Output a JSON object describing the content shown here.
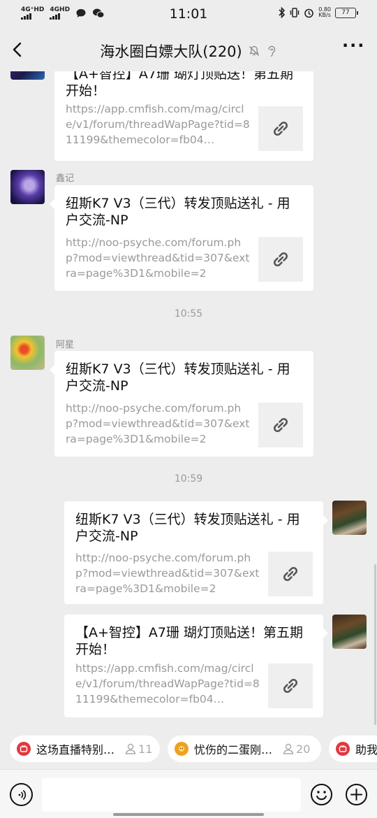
{
  "status": {
    "net1": "4G⁺HD",
    "net2": "4GHD",
    "time": "11:01",
    "speed_value": "0.80",
    "speed_unit": "KB/s",
    "battery": "77"
  },
  "header": {
    "title": "海水圈白嫖大队(220)"
  },
  "messages": [
    {
      "title": "【A+智控】A7珊 瑚灯顶贴送！第五期开始！",
      "desc": "https://app.cmfish.com/mag/circle/v1/forum/threadWapPage?tid=811199&themecolor=fb04…"
    },
    {
      "sender": "鑫记",
      "title": "纽斯K7 V3（三代）转发顶贴送礼 - 用户交流-NP",
      "desc": "http://noo-psyche.com/forum.php?mod=viewthread&tid=307&extra=page%3D1&mobile=2"
    },
    {
      "time": "10:55"
    },
    {
      "sender": "阿星",
      "title": "纽斯K7 V3（三代）转发顶贴送礼 - 用户交流-NP",
      "desc": "http://noo-psyche.com/forum.php?mod=viewthread&tid=307&extra=page%3D1&mobile=2"
    },
    {
      "time": "10:59"
    },
    {
      "title": "纽斯K7 V3（三代）转发顶贴送礼 - 用户交流-NP",
      "desc": "http://noo-psyche.com/forum.php?mod=viewthread&tid=307&extra=page%3D1&mobile=2"
    },
    {
      "title": "【A+智控】A7珊 瑚灯顶贴送！第五期开始！",
      "desc": "https://app.cmfish.com/mag/circle/v1/forum/threadWapPage?tid=811199&themecolor=fb04…"
    }
  ],
  "chips": [
    {
      "text": "这场直播特别…",
      "count": "11",
      "icon_color": "#e0393e"
    },
    {
      "text": "忧伤的二蛋刚…",
      "count": "20",
      "icon_color": "#f0a020"
    },
    {
      "text": "助我",
      "count": "",
      "icon_color": "#e0393e"
    }
  ],
  "colors": {
    "background": "#ededed",
    "bubble": "#ffffff",
    "meta_text": "#999999"
  }
}
